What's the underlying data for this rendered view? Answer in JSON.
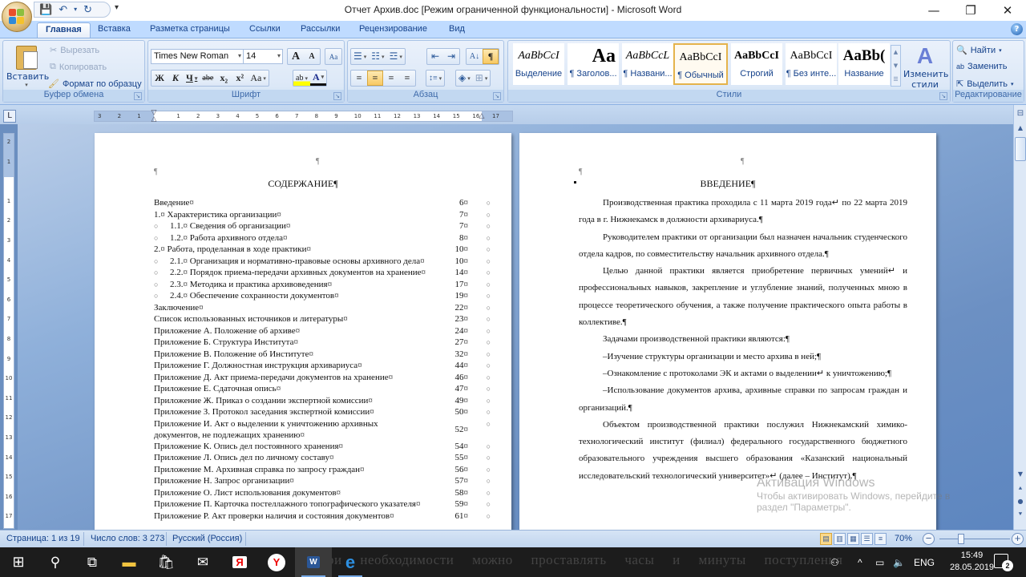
{
  "window": {
    "title": "Отчет Архив.doc [Режим ограниченной функциональности] - Microsoft Word",
    "minimize": "—",
    "restore": "❐",
    "close": "✕"
  },
  "qat": {
    "save": "💾",
    "undo": "↶",
    "undo_dd": "▾",
    "redo": "↻",
    "customize": "▾"
  },
  "tabs": [
    "Главная",
    "Вставка",
    "Разметка страницы",
    "Ссылки",
    "Рассылки",
    "Рецензирование",
    "Вид"
  ],
  "active_tab": "Главная",
  "help": "?",
  "ribbon": {
    "clipboard": {
      "label": "Буфер обмена",
      "paste": "Вставить",
      "paste_dd": "▾",
      "cut": "Вырезать",
      "copy": "Копировать",
      "format_painter": "Формат по образцу"
    },
    "font": {
      "label": "Шрифт",
      "family": "Times New Roman",
      "size": "14",
      "grow": "A",
      "shrink": "A",
      "clear": "Aa",
      "bold": "Ж",
      "italic": "К",
      "underline": "Ч",
      "strikethrough": "abe",
      "subscript": "x₂",
      "superscript": "x²",
      "change_case": "Aa",
      "highlight": "ab",
      "font_color": "A"
    },
    "paragraph": {
      "label": "Абзац",
      "bullets": "☰",
      "numbering": "☷",
      "multilevel": "☲",
      "decrease_indent": "⇤",
      "increase_indent": "⇥",
      "sort": "A↓",
      "show_marks": "¶",
      "align_left": "≡",
      "align_center": "≡",
      "align_right": "≡",
      "justify": "≡",
      "line_spacing": "↕≡",
      "shading": "◈",
      "borders": "⊞"
    },
    "styles": {
      "label": "Стили",
      "items": [
        {
          "sample": "AaBbCcI",
          "name": "Выделение"
        },
        {
          "sample": "Aa",
          "name": "¶ Заголов..."
        },
        {
          "sample": "AaBbCcL",
          "name": "¶ Названи..."
        },
        {
          "sample": "AaBbCcI",
          "name": "¶ Обычный"
        },
        {
          "sample": "AaBbCcI",
          "name": "Строгий"
        },
        {
          "sample": "AaBbCcI",
          "name": "¶ Без инте..."
        },
        {
          "sample": "AaBb(",
          "name": "Название"
        }
      ],
      "selected_index": 3,
      "change_styles": "Изменить стили"
    },
    "editing": {
      "label": "Редактирование",
      "find": "Найти",
      "replace": "Заменить",
      "select": "Выделить"
    }
  },
  "ruler": {
    "tab_selector": "L",
    "h_numbers": [
      "3",
      "2",
      "1",
      "",
      "1",
      "2",
      "3",
      "4",
      "5",
      "6",
      "7",
      "8",
      "9",
      "10",
      "11",
      "12",
      "13",
      "14",
      "15",
      "16",
      "17"
    ],
    "v_numbers": [
      "2",
      "1",
      "",
      "1",
      "2",
      "3",
      "4",
      "5",
      "6",
      "7",
      "8",
      "9",
      "10",
      "11",
      "12",
      "13",
      "14",
      "15",
      "16",
      "17"
    ]
  },
  "page1": {
    "top_mark": "¶",
    "left_mark": "¶",
    "heading": "СОДЕРЖАНИЕ¶",
    "toc": [
      {
        "title": "Введение¤",
        "page": "6¤",
        "level": 0
      },
      {
        "title": "1.¤ Характеристика организации¤",
        "page": "7¤",
        "level": 0
      },
      {
        "title": "1.1.¤ Сведения об организации¤",
        "page": "7¤",
        "level": 1
      },
      {
        "title": "1.2.¤ Работа архивного отдела¤",
        "page": "8¤",
        "level": 1
      },
      {
        "title": "2.¤ Работа, проделанная в ходе практики¤",
        "page": "10¤",
        "level": 0
      },
      {
        "title": "2.1.¤ Организация и нормативно-правовые основы архивного дела¤",
        "page": "10¤",
        "level": 1
      },
      {
        "title": "2.2.¤ Порядок приема-передачи архивных документов на хранение¤",
        "page": "14¤",
        "level": 1
      },
      {
        "title": "2.3.¤ Методика и практика архивоведения¤",
        "page": "17¤",
        "level": 1
      },
      {
        "title": "2.4.¤ Обеспечение сохранности документов¤",
        "page": "19¤",
        "level": 1
      },
      {
        "title": "Заключение¤",
        "page": "22¤",
        "level": 0
      },
      {
        "title": "Список использованных источников и литературы¤",
        "page": "23¤",
        "level": 0
      },
      {
        "title": "Приложение А. Положение об архиве¤",
        "page": "24¤",
        "level": 0
      },
      {
        "title": "Приложение Б. Структура Института¤",
        "page": "27¤",
        "level": 0
      },
      {
        "title": "Приложение В. Положение об Институте¤",
        "page": "32¤",
        "level": 0
      },
      {
        "title": "Приложение Г. Должностная инструкция архивариуса¤",
        "page": "44¤",
        "level": 0
      },
      {
        "title": "Приложение Д. Акт приема-передачи документов на хранение¤",
        "page": "46¤",
        "level": 0
      },
      {
        "title": "Приложение Е. Сдаточная опись¤",
        "page": "47¤",
        "level": 0
      },
      {
        "title": "Приложение Ж. Приказ о создании экспертной комиссии¤",
        "page": "49¤",
        "level": 0
      },
      {
        "title": "Приложение З. Протокол заседания экспертной комиссии¤",
        "page": "50¤",
        "level": 0
      },
      {
        "title": "Приложение И. Акт о выделении к уничтожению архивных документов, не подлежащих хранению¤",
        "page": "52¤",
        "level": 0,
        "tall": true
      },
      {
        "title": "Приложение К. Опись дел постоянного хранения¤",
        "page": "54¤",
        "level": 0
      },
      {
        "title": "Приложение Л. Опись дел по личному составу¤",
        "page": "55¤",
        "level": 0
      },
      {
        "title": "Приложение М. Архивная справка по запросу граждан¤",
        "page": "56¤",
        "level": 0
      },
      {
        "title": "Приложение Н. Запрос организации¤",
        "page": "57¤",
        "level": 0
      },
      {
        "title": "Приложение О. Лист использования документов¤",
        "page": "58¤",
        "level": 0
      },
      {
        "title": "Приложение П. Карточка постеллажного топографического указателя¤",
        "page": "59¤",
        "level": 0
      },
      {
        "title": "Приложение Р. Акт проверки наличия и состояния документов¤",
        "page": "61¤",
        "level": 0
      }
    ],
    "level1_bullet": "○",
    "row_end_mark": "○"
  },
  "page2": {
    "top_mark": "¶",
    "left_mark": "¶",
    "heading": "ВВЕДЕНИЕ¶",
    "paragraphs": [
      "Производственная практика проходила с 11 марта 2019 года↵ по 22 марта 2019 года в г. Нижнекамск в должности архивариуса.¶",
      "Руководителем практики от организации был назначен начальник студенческого отдела кадров, по совместительству начальник архивного отдела.¶",
      "Целью данной практики является приобретение первичных умений↵ и профессиональных навыков, закрепление и углубление знаний, полученных мною в процессе теоретического обучения, а также получение практического опыта работы в коллективе.¶",
      "Задачами производственной практики являются:¶",
      "–Изучение структуры организации и место архива в ней;¶",
      "–Ознакомление с протоколами ЭК и актами о выделении↵ к уничтожению;¶",
      "–Использование документов архива, архивные справки по запросам граждан и организаций.¶",
      "Объектом производственной практики послужил Нижнекамский химико-технологический институт (филиал) федерального государственного бюджетного образовательного учреждения высшего образования «Казанский национальный исследовательский технологический университет»↵ (далее – Институт).¶"
    ]
  },
  "watermark": {
    "line1": "Активация Windows",
    "line2": "Чтобы активировать Windows, перейдите в",
    "line3": "раздел \"Параметры\"."
  },
  "statusbar": {
    "page": "Страница: 1 из 19",
    "words": "Число слов: 3 273",
    "language": "Русский (Россия)",
    "zoom": "70%",
    "zoom_value_percent": 70
  },
  "taskbar": {
    "bleed_text": "ри необходимости можно проставлять часы и минуты поступления",
    "language": "ENG",
    "time": "15:49",
    "date": "28.05.2019",
    "notifications": "2"
  }
}
